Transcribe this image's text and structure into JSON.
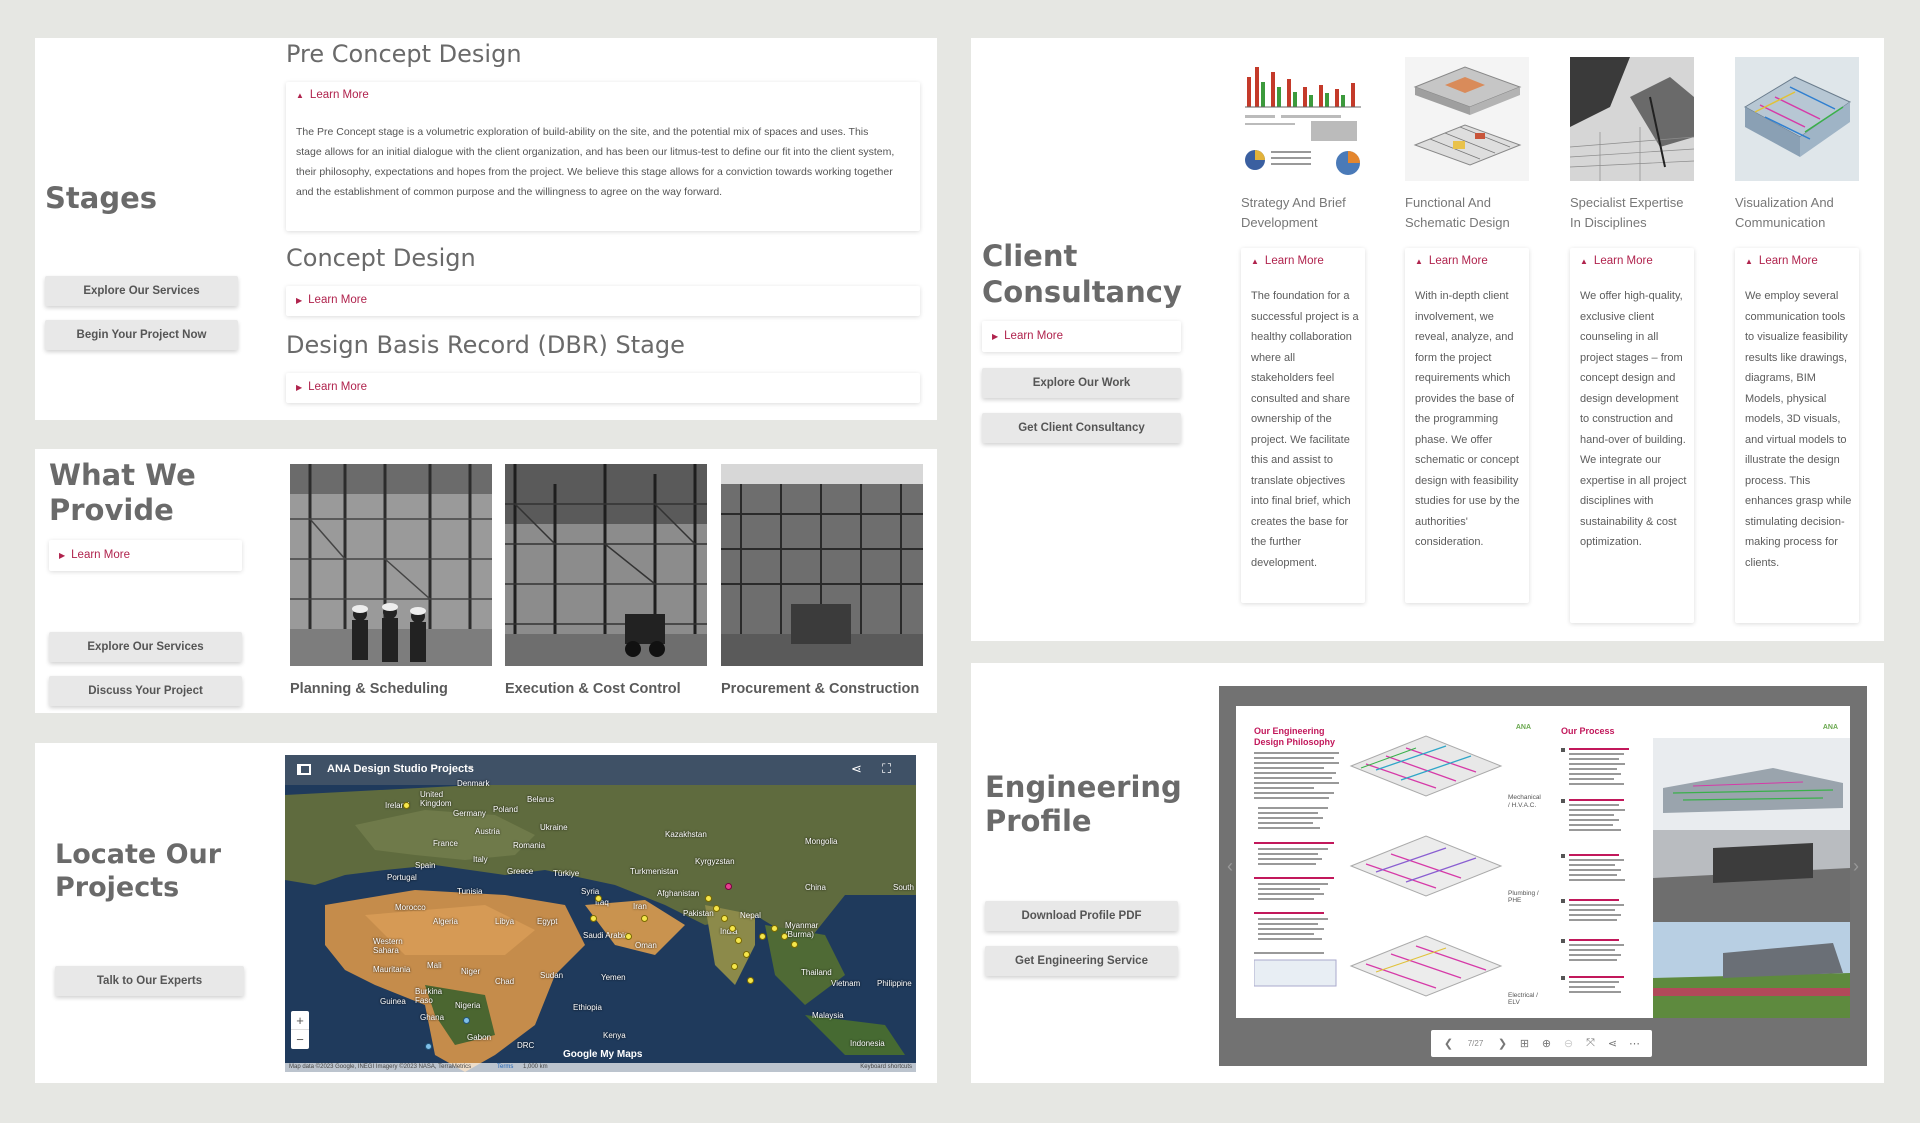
{
  "stages": {
    "title": "Stages",
    "buttons": [
      "Explore Our Services",
      "Begin Your Project Now"
    ],
    "items": [
      {
        "heading": "Pre Concept Design",
        "learn": "Learn More",
        "text": "The Pre Concept stage is a volumetric exploration of build-ability on the site, and the potential mix of spaces and uses. This stage allows for an initial dialogue with the client organization, and has been our litmus-test to define our fit into the client system, their philosophy, expectations and hopes from the project. We believe this stage allows for a conviction towards working together and the establishment of common purpose and the willingness to agree on the way forward."
      },
      {
        "heading": "Concept Design",
        "learn": "Learn More"
      },
      {
        "heading": "Design Basis Record (DBR) Stage",
        "learn": "Learn More"
      }
    ]
  },
  "provide": {
    "title": "What We Provide",
    "learn": "Learn More",
    "buttons": [
      "Explore Our Services",
      "Discuss Your Project"
    ],
    "photos": [
      {
        "caption": "Planning & Scheduling"
      },
      {
        "caption": "Execution & Cost Control"
      },
      {
        "caption": "Procurement & Construction"
      }
    ]
  },
  "locate": {
    "title": "Locate Our Projects",
    "button": "Talk to Our Experts",
    "map": {
      "title": "ANA Design Studio Projects",
      "zoom_in": "+",
      "zoom_out": "−",
      "footer_left": "Map data ©2023 Google, INEGI Imagery ©2023 NASA, TerraMetrics",
      "footer_terms": "Terms",
      "footer_scale": "1,000 km",
      "footer_right": "Keyboard shortcuts",
      "watermark": "Google My Maps",
      "labels": [
        "Ireland",
        "United Kingdom",
        "Denmark",
        "Belarus",
        "Germany",
        "Poland",
        "Ukraine",
        "Austria",
        "France",
        "Romania",
        "Kazakhstan",
        "Mongolia",
        "Spain",
        "Italy",
        "Greece",
        "Türkiye",
        "Turkmenistan",
        "Kyrgyzstan",
        "Portugal",
        "Tunisia",
        "Syria",
        "Iraq",
        "Iran",
        "Afghanistan",
        "Pakistan",
        "China",
        "South",
        "Morocco",
        "Algeria",
        "Libya",
        "Egypt",
        "Saudi Arabia",
        "Oman",
        "India",
        "Nepal",
        "Myanmar (Burma)",
        "Western Sahara",
        "Mali",
        "Niger",
        "Chad",
        "Sudan",
        "Yemen",
        "Thailand",
        "Philippine",
        "Mauritania",
        "Burkina Faso",
        "Nigeria",
        "Ethiopia",
        "Vietnam",
        "Guinea",
        "Ghana",
        "Malaysia",
        "Gabon",
        "DRC",
        "Kenya",
        "Indonesia"
      ]
    }
  },
  "consultancy": {
    "title": "Client Consultancy",
    "learn": "Learn More",
    "buttons": [
      "Explore Our Work",
      "Get Client Consultancy"
    ],
    "services": [
      {
        "title": "Strategy And Brief Development",
        "learn": "Learn More",
        "text": "The foundation for a successful project is a healthy collaboration where all stakeholders feel consulted and share ownership of the project. We facilitate this and assist to translate objectives into final brief, which creates the base for the further development."
      },
      {
        "title": "Functional And Schematic Design",
        "learn": "Learn More",
        "text": "With in-depth client involvement, we reveal, analyze, and form the project requirements which provides the base of the programming phase. We offer schematic or concept design with feasibility studies for use by the authorities' consideration."
      },
      {
        "title": "Specialist Expertise In Disciplines",
        "learn": "Learn More",
        "text": "We offer high-quality, exclusive client counseling in all project stages – from concept design and design development to construction and hand-over of building. We integrate our expertise in all project disciplines with sustainability & cost optimization."
      },
      {
        "title": "Visualization And Communication",
        "learn": "Learn More",
        "text": "We employ several communication tools to visualize feasibility results like drawings, diagrams, BIM Models, physical models, 3D visuals, and virtual models to illustrate the design process.  This  enhances grasp while stimulating decision-making process for clients."
      }
    ]
  },
  "engineering": {
    "title": "Engineering Profile",
    "buttons": [
      "Download Profile PDF",
      "Get Engineering Service"
    ],
    "viewer": {
      "left_heading": "Our Engineering Design Philosophy",
      "left_labels": [
        "Mechanical / H.V.A.C.",
        "Plumbing / PHE",
        "Electrical / ELV"
      ],
      "right_heading": "Our Process",
      "logo": "ANA",
      "page": "7/27"
    }
  },
  "colors": {
    "accent": "#b0234d",
    "background": "#e6e7e3",
    "panel": "#ffffff"
  }
}
